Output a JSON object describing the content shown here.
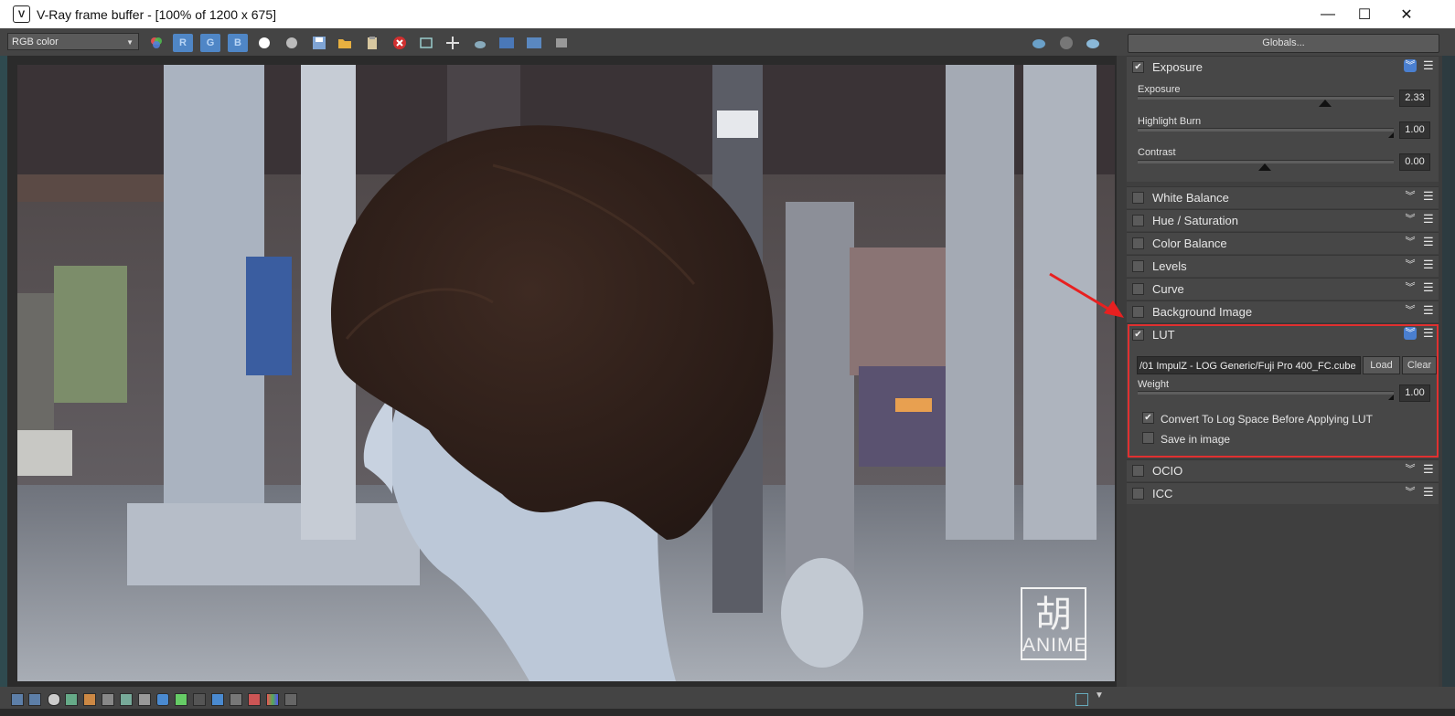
{
  "window": {
    "title": "V-Ray frame buffer - [100% of 1200 x 675]",
    "app_icon_glyph": "V"
  },
  "controls": {
    "minimize": "—",
    "maximize": "☐",
    "close": "✕"
  },
  "toolbar": {
    "channel_select": "RGB color",
    "r_label": "R",
    "g_label": "G",
    "b_label": "B",
    "globals_label": "Globals..."
  },
  "watermark": {
    "mark": "胡",
    "text": "ANIME"
  },
  "panel": {
    "exposure": {
      "title": "Exposure",
      "params": [
        {
          "label": "Exposure",
          "value": "2.33"
        },
        {
          "label": "Highlight Burn",
          "value": "1.00"
        },
        {
          "label": "Contrast",
          "value": "0.00"
        }
      ]
    },
    "sections": [
      "White Balance",
      "Hue / Saturation",
      "Color Balance",
      "Levels",
      "Curve",
      "Background Image"
    ],
    "lut": {
      "title": "LUT",
      "path": "/01 ImpulZ - LOG Generic/Fuji Pro 400_FC.cube",
      "load_label": "Load",
      "clear_label": "Clear",
      "weight_label": "Weight",
      "weight_value": "1.00",
      "convert_label": "Convert To Log Space Before Applying LUT",
      "convert_checked": true,
      "save_label": "Save in image",
      "save_checked": false
    },
    "bottom_sections": [
      "OCIO",
      "ICC"
    ]
  },
  "colors": {
    "accent": "#4a7fd0",
    "highlight": "#e03030"
  }
}
